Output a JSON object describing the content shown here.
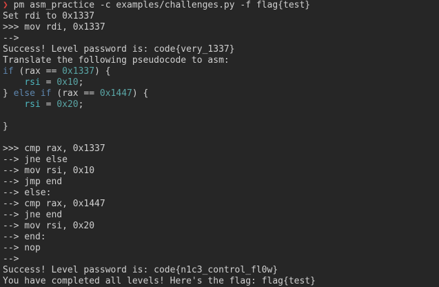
{
  "terminal": {
    "prompt_symbol": "❯",
    "prompt_command": " pm asm_practice -c examples/challenges.py -f flag{test}",
    "set_rdi": "Set rdi to 0x1337",
    "input_mov": ">>> mov rdi, 0x1337",
    "cont_empty_1": "-->",
    "success_1": "Success! Level password is: code{very_1337}",
    "translate_msg": "Translate the following pseudocode to asm:",
    "code": {
      "if_kw": "if",
      "if_cond_open": " (rax == ",
      "if_value": "0x1337",
      "if_cond_close": ") {",
      "rsi1_indent": "    ",
      "rsi1_name": "rsi",
      "rsi1_eq": " = ",
      "rsi1_value": "0x10",
      "rsi1_semi": ";",
      "else_close": "} ",
      "else_kw": "else if",
      "else_cond_open": " (rax == ",
      "else_value": "0x1447",
      "else_cond_close": ") {",
      "rsi2_indent": "    ",
      "rsi2_name": "rsi",
      "rsi2_eq": " = ",
      "rsi2_value": "0x20",
      "rsi2_semi": ";",
      "close_brace": "}"
    },
    "asm_lines": [
      ">>> cmp rax, 0x1337",
      "--> jne else",
      "--> mov rsi, 0x10",
      "--> jmp end",
      "--> else:",
      "--> cmp rax, 0x1447",
      "--> jne end",
      "--> mov rsi, 0x20",
      "--> end:",
      "--> nop",
      "-->"
    ],
    "success_2": "Success! Level password is: code{n1c3_control_fl0w}",
    "completed": "You have completed all levels! Here's the flag: flag{test}"
  },
  "colors": {
    "background": "#262626",
    "foreground": "#d0d0d0",
    "prompt_symbol": "#d7433f",
    "keyword": "#5f87af",
    "number": "#5aa6a6"
  }
}
